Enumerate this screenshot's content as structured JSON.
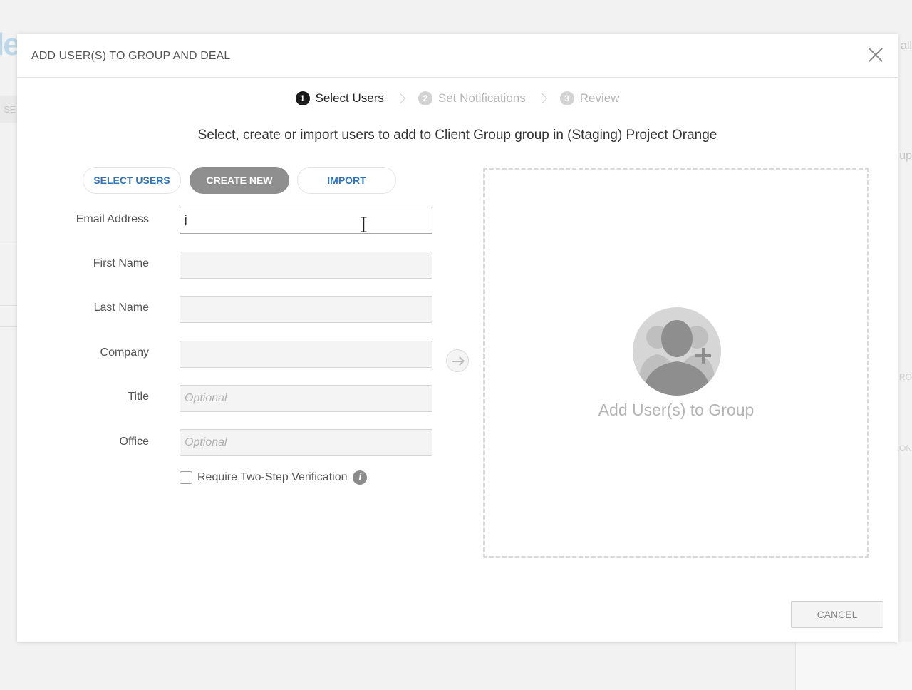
{
  "background": {
    "logo_fragment": "le",
    "left_label": "SE",
    "right_fragments": [
      "all",
      "up",
      "T RO",
      "ION"
    ]
  },
  "modal": {
    "title": "ADD USER(S) TO GROUP AND DEAL",
    "close_label": "×",
    "steps": [
      {
        "number": "1",
        "label": "Select Users",
        "state": "active"
      },
      {
        "number": "2",
        "label": "Set Notifications",
        "state": "inactive"
      },
      {
        "number": "3",
        "label": "Review",
        "state": "inactive"
      }
    ],
    "subtitle": "Select, create or import users to add to Client Group group in (Staging) Project Orange",
    "tabs": {
      "select_users": "SELECT USERS",
      "create_new": "CREATE NEW",
      "import": "IMPORT",
      "selected": "create_new"
    },
    "form": {
      "email_label": "Email Address",
      "email_value": "j",
      "first_name_label": "First Name",
      "first_name_value": "",
      "last_name_label": "Last Name",
      "last_name_value": "",
      "company_label": "Company",
      "company_value": "",
      "title_label": "Title",
      "title_placeholder": "Optional",
      "office_label": "Office",
      "office_placeholder": "Optional",
      "two_step_label": "Require Two-Step Verification",
      "two_step_checked": false,
      "info_icon": "i"
    },
    "dropzone": {
      "label": "Add User(s) to Group",
      "icon": "add-users-icon"
    },
    "cancel_label": "CANCEL"
  },
  "colors": {
    "link_blue": "#2f74b5",
    "tab_selected": "#8f8f8f",
    "step_active": "#1a1a1a",
    "step_inactive": "#d3d3d3"
  }
}
